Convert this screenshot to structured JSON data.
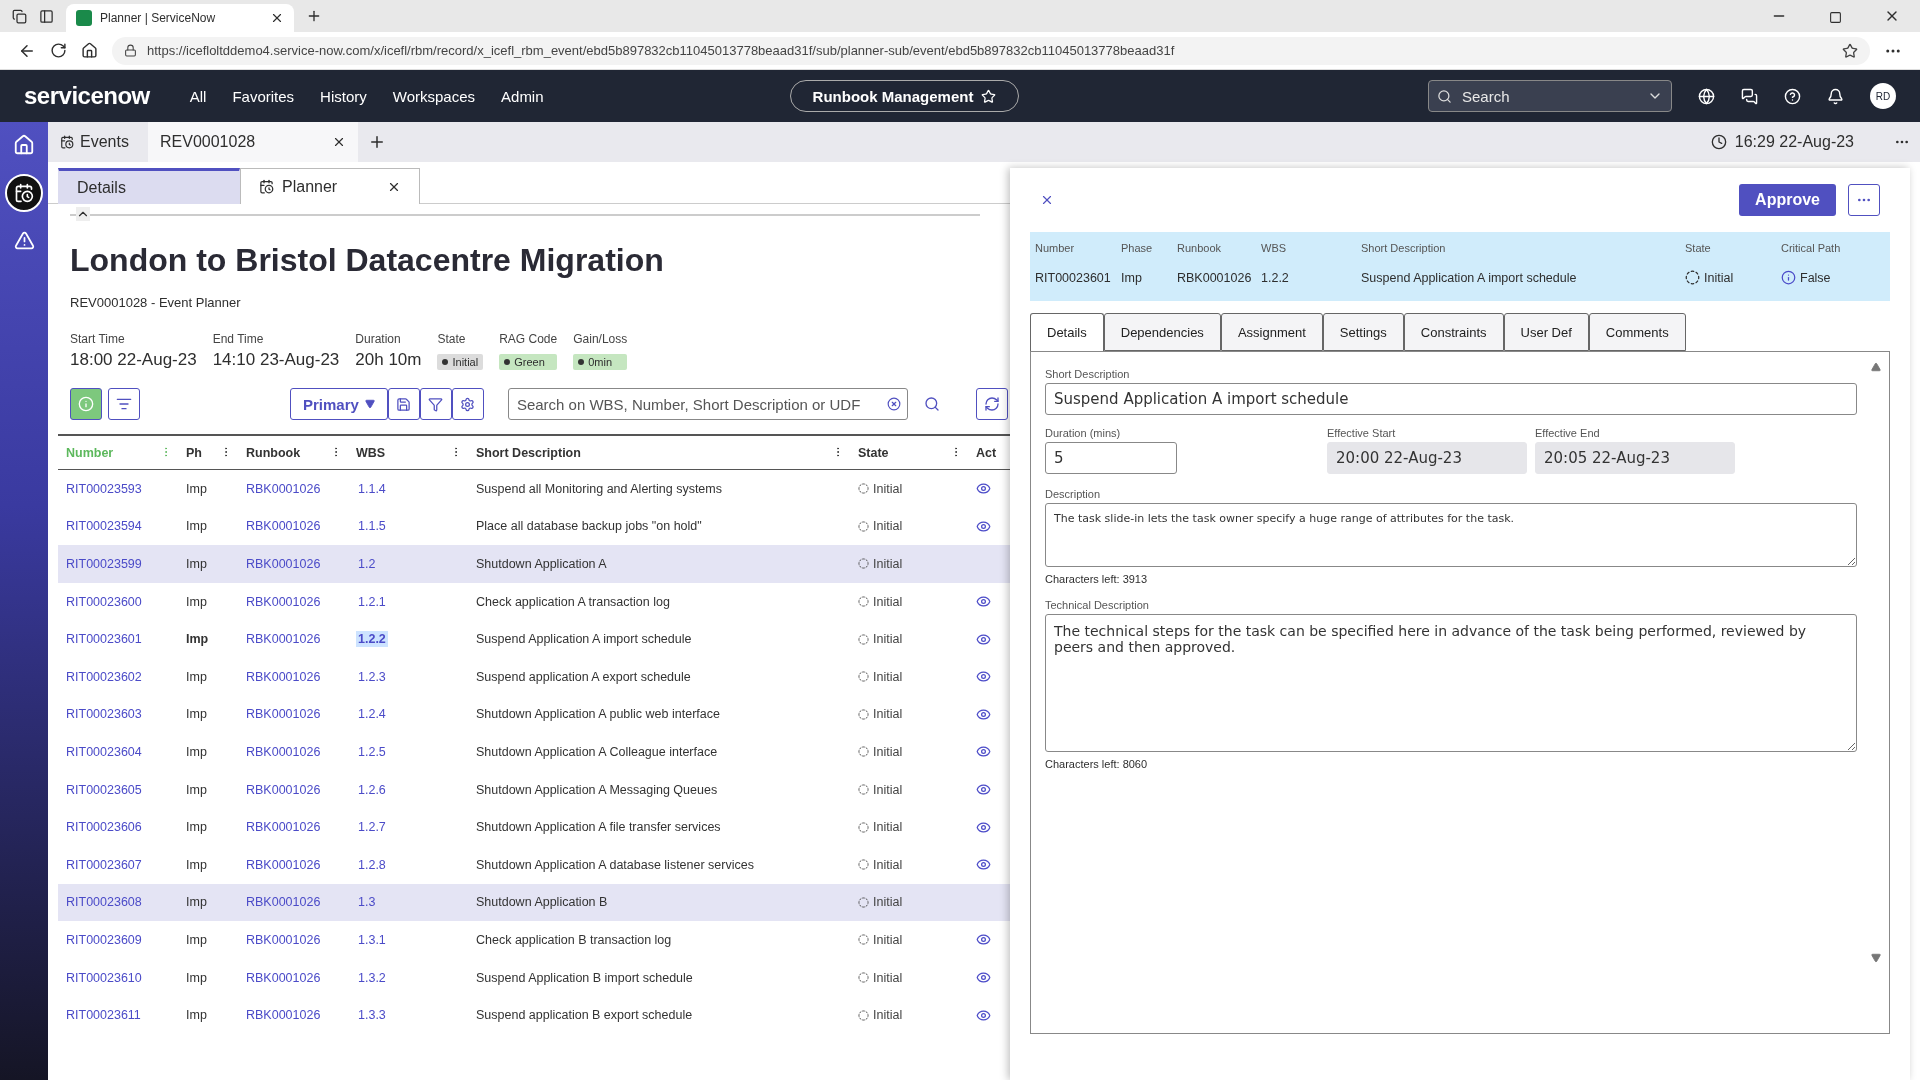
{
  "browser": {
    "tab_title": "Planner | ServiceNow",
    "url": "https://icefloltddemo4.service-now.com/x/icefl/rbm/record/x_icefl_rbm_event/ebd5b897832cb11045013778beaad31f/sub/planner-sub/event/ebd5b897832cb11045013778beaad31f"
  },
  "nav": {
    "brand": "servicenow",
    "menu": [
      "All",
      "Favorites",
      "History",
      "Workspaces",
      "Admin"
    ],
    "app_button": "Runbook Management",
    "search": {
      "placeholder": "Search"
    },
    "avatar": "RD"
  },
  "workspace_tabs": [
    {
      "label": "Events",
      "selected": false
    },
    {
      "label": "REV0001028",
      "selected": true
    }
  ],
  "clock": "16:29 22-Aug-23",
  "record_tabs": [
    {
      "label": "Details",
      "selected": false
    },
    {
      "label": "Planner",
      "selected": true
    }
  ],
  "header": {
    "title": "London to Bristol Datacentre Migration",
    "subtitle": "REV0001028 - Event Planner",
    "fields": [
      {
        "label": "Start Time",
        "value": "18:00 22-Aug-23",
        "kind": "text"
      },
      {
        "label": "End Time",
        "value": "14:10 23-Aug-23",
        "kind": "text"
      },
      {
        "label": "Duration",
        "value": "20h 10m",
        "kind": "text"
      },
      {
        "label": "State",
        "value": "Initial",
        "kind": "badge",
        "color": "#dcdcdc"
      },
      {
        "label": "RAG Code",
        "value": "Green",
        "kind": "badge",
        "color": "#c5e6c0"
      },
      {
        "label": "Gain/Loss",
        "value": "0min",
        "kind": "badge",
        "color": "#c5e6c0"
      }
    ]
  },
  "toolbar": {
    "view_button": "Primary",
    "search": {
      "placeholder": "Search on WBS, Number, Short Description or UDF"
    }
  },
  "table": {
    "columns": [
      "Number",
      "Ph",
      "Runbook",
      "WBS",
      "Short Description",
      "State",
      "Act"
    ],
    "rows": [
      {
        "number": "RIT00023593",
        "phase": "Imp",
        "runbook": "RBK0001026",
        "wbs": "1.1.4",
        "description": "Suspend all Monitoring and Alerting systems",
        "state": "Initial",
        "kind": "task",
        "selected": false
      },
      {
        "number": "RIT00023594",
        "phase": "Imp",
        "runbook": "RBK0001026",
        "wbs": "1.1.5",
        "description": "Place all database backup jobs \"on hold\"",
        "state": "Initial",
        "kind": "task",
        "selected": false
      },
      {
        "number": "RIT00023599",
        "phase": "Imp",
        "runbook": "RBK0001026",
        "wbs": "1.2",
        "description": "Shutdown Application A",
        "state": "Initial",
        "kind": "group",
        "selected": false
      },
      {
        "number": "RIT00023600",
        "phase": "Imp",
        "runbook": "RBK0001026",
        "wbs": "1.2.1",
        "description": "Check application A transaction log",
        "state": "Initial",
        "kind": "task",
        "selected": false
      },
      {
        "number": "RIT00023601",
        "phase": "Imp",
        "runbook": "RBK0001026",
        "wbs": "1.2.2",
        "description": "Suspend Application A import schedule",
        "state": "Initial",
        "kind": "task",
        "selected": true
      },
      {
        "number": "RIT00023602",
        "phase": "Imp",
        "runbook": "RBK0001026",
        "wbs": "1.2.3",
        "description": "Suspend application A export schedule",
        "state": "Initial",
        "kind": "task",
        "selected": false
      },
      {
        "number": "RIT00023603",
        "phase": "Imp",
        "runbook": "RBK0001026",
        "wbs": "1.2.4",
        "description": "Shutdown Application A public web interface",
        "state": "Initial",
        "kind": "task",
        "selected": false
      },
      {
        "number": "RIT00023604",
        "phase": "Imp",
        "runbook": "RBK0001026",
        "wbs": "1.2.5",
        "description": "Shutdown Application A Colleague interface",
        "state": "Initial",
        "kind": "task",
        "selected": false
      },
      {
        "number": "RIT00023605",
        "phase": "Imp",
        "runbook": "RBK0001026",
        "wbs": "1.2.6",
        "description": "Shutdown Application A Messaging Queues",
        "state": "Initial",
        "kind": "task",
        "selected": false
      },
      {
        "number": "RIT00023606",
        "phase": "Imp",
        "runbook": "RBK0001026",
        "wbs": "1.2.7",
        "description": "Shutdown Application A file transfer services",
        "state": "Initial",
        "kind": "task",
        "selected": false
      },
      {
        "number": "RIT00023607",
        "phase": "Imp",
        "runbook": "RBK0001026",
        "wbs": "1.2.8",
        "description": "Shutdown Application A database listener services",
        "state": "Initial",
        "kind": "task",
        "selected": false
      },
      {
        "number": "RIT00023608",
        "phase": "Imp",
        "runbook": "RBK0001026",
        "wbs": "1.3",
        "description": "Shutdown Application B",
        "state": "Initial",
        "kind": "group",
        "selected": false
      },
      {
        "number": "RIT00023609",
        "phase": "Imp",
        "runbook": "RBK0001026",
        "wbs": "1.3.1",
        "description": "Check application B transaction log",
        "state": "Initial",
        "kind": "task",
        "selected": false
      },
      {
        "number": "RIT00023610",
        "phase": "Imp",
        "runbook": "RBK0001026",
        "wbs": "1.3.2",
        "description": "Suspend Application B import schedule",
        "state": "Initial",
        "kind": "task",
        "selected": false
      },
      {
        "number": "RIT00023611",
        "phase": "Imp",
        "runbook": "RBK0001026",
        "wbs": "1.3.3",
        "description": "Suspend application B export schedule",
        "state": "Initial",
        "kind": "task",
        "selected": false
      }
    ]
  },
  "panel": {
    "approve_button": "Approve",
    "summary": [
      {
        "label": "Number",
        "value": "RIT00023601",
        "kind": "text"
      },
      {
        "label": "Phase",
        "value": "Imp",
        "kind": "text"
      },
      {
        "label": "Runbook",
        "value": "RBK0001026",
        "kind": "text"
      },
      {
        "label": "WBS",
        "value": "1.2.2",
        "kind": "text"
      },
      {
        "label": "Short Description",
        "value": "Suspend Application A import schedule",
        "kind": "text"
      },
      {
        "label": "State",
        "value": "Initial",
        "kind": "state"
      },
      {
        "label": "Critical Path",
        "value": "False",
        "kind": "info"
      }
    ],
    "tabs": [
      {
        "label": "Details",
        "selected": true
      },
      {
        "label": "Dependencies",
        "selected": false
      },
      {
        "label": "Assignment",
        "selected": false
      },
      {
        "label": "Settings",
        "selected": false
      },
      {
        "label": "Constraints",
        "selected": false
      },
      {
        "label": "User Def",
        "selected": false
      },
      {
        "label": "Comments",
        "selected": false
      }
    ],
    "short_description": {
      "label": "Short Description",
      "value": "Suspend Application A import schedule"
    },
    "duration": {
      "label": "Duration (mins)",
      "value": "5"
    },
    "effective_start": {
      "label": "Effective Start",
      "value": "20:00 22-Aug-23"
    },
    "effective_end": {
      "label": "Effective End",
      "value": "20:05 22-Aug-23"
    },
    "description": {
      "label": "Description",
      "value": "The task slide-in lets the task owner specify a huge range of attributes for the task.",
      "counter": "Characters left: 3913"
    },
    "technical_description": {
      "label": "Technical Description",
      "value": "The technical steps for the task can be specified here in advance of the task being performed, reviewed by peers and then approved.",
      "counter": "Characters left: 8060"
    }
  }
}
